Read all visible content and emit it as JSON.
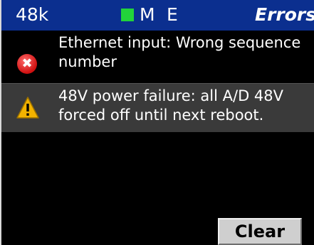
{
  "header": {
    "rate": "48k",
    "indicator_color": "#22d33a",
    "mode_m": "M",
    "mode_e": "E",
    "title": "Errors"
  },
  "messages": [
    {
      "severity": "error",
      "icon": "error-icon",
      "text": "Ethernet input: Wrong sequence\nnumber"
    },
    {
      "severity": "warning",
      "icon": "warning-icon",
      "text": "48V power failure: all A/D 48V\nforced off until next reboot."
    }
  ],
  "buttons": {
    "clear": "Clear"
  },
  "colors": {
    "header_bg": "#0b2f8f",
    "panel_bg": "#000000",
    "selected_row_bg": "#3a3a3a",
    "error_icon": "#d01010",
    "warning_icon": "#f2b200"
  }
}
